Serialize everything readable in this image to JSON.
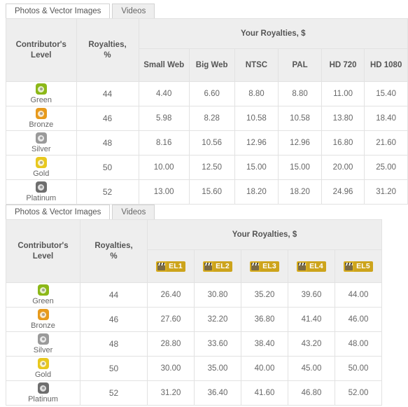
{
  "panels": [
    {
      "id": "photos",
      "tabs": [
        {
          "label": "Photos & Vector Images",
          "active": true
        },
        {
          "label": "Videos",
          "active": false
        }
      ],
      "table": {
        "headers": {
          "level": "Contributor's Level",
          "level_line1": "Contributor's",
          "level_line2": "Level",
          "percent": "Royalties, %",
          "percent_line1": "Royalties,",
          "percent_line2": "%",
          "group": "Your Royalties, $"
        },
        "columns": [
          "Small Web",
          "Big Web",
          "NTSC",
          "PAL",
          "HD 720",
          "HD 1080"
        ],
        "rows": [
          {
            "level": "Green",
            "color": "#8cb818",
            "percent": "44",
            "values": [
              "4.40",
              "6.60",
              "8.80",
              "8.80",
              "11.00",
              "15.40"
            ]
          },
          {
            "level": "Bronze",
            "color": "#e79a1c",
            "percent": "46",
            "values": [
              "5.98",
              "8.28",
              "10.58",
              "10.58",
              "13.80",
              "18.40"
            ]
          },
          {
            "level": "Silver",
            "color": "#9a9a9a",
            "percent": "48",
            "values": [
              "8.16",
              "10.56",
              "12.96",
              "12.96",
              "16.80",
              "21.60"
            ]
          },
          {
            "level": "Gold",
            "color": "#e8c81e",
            "percent": "50",
            "values": [
              "10.00",
              "12.50",
              "15.00",
              "15.00",
              "20.00",
              "25.00"
            ]
          },
          {
            "level": "Platinum",
            "color": "#6e6e6e",
            "percent": "52",
            "values": [
              "13.00",
              "15.60",
              "18.20",
              "18.20",
              "24.96",
              "31.20"
            ]
          }
        ]
      }
    },
    {
      "id": "videos",
      "tabs": [
        {
          "label": "Photos & Vector Images",
          "active": true
        },
        {
          "label": "Videos",
          "active": false
        }
      ],
      "table": {
        "headers": {
          "level": "Contributor's Level",
          "level_line1": "Contributor's",
          "level_line2": "Level",
          "percent": "Royalties, %",
          "percent_line1": "Royalties,",
          "percent_line2": "%",
          "group": "Your Royalties, $"
        },
        "columns": [
          "EL1",
          "EL2",
          "EL3",
          "EL4",
          "EL5"
        ],
        "column_icon": "clapperboard-icon",
        "rows": [
          {
            "level": "Green",
            "color": "#8cb818",
            "percent": "44",
            "values": [
              "26.40",
              "30.80",
              "35.20",
              "39.60",
              "44.00"
            ]
          },
          {
            "level": "Bronze",
            "color": "#e79a1c",
            "percent": "46",
            "values": [
              "27.60",
              "32.20",
              "36.80",
              "41.40",
              "46.00"
            ]
          },
          {
            "level": "Silver",
            "color": "#9a9a9a",
            "percent": "48",
            "values": [
              "28.80",
              "33.60",
              "38.40",
              "43.20",
              "48.00"
            ]
          },
          {
            "level": "Gold",
            "color": "#e8c81e",
            "percent": "50",
            "values": [
              "30.00",
              "35.00",
              "40.00",
              "45.00",
              "50.00"
            ]
          },
          {
            "level": "Platinum",
            "color": "#6e6e6e",
            "percent": "52",
            "values": [
              "31.20",
              "36.40",
              "41.60",
              "46.80",
              "52.00"
            ]
          }
        ]
      }
    }
  ],
  "colors": {
    "header_bg": "#eeeeee",
    "level_col_bg": "#f2f2f2",
    "border": "#e2e2e2",
    "text": "#666666",
    "badge_gold": "#cda41c"
  }
}
